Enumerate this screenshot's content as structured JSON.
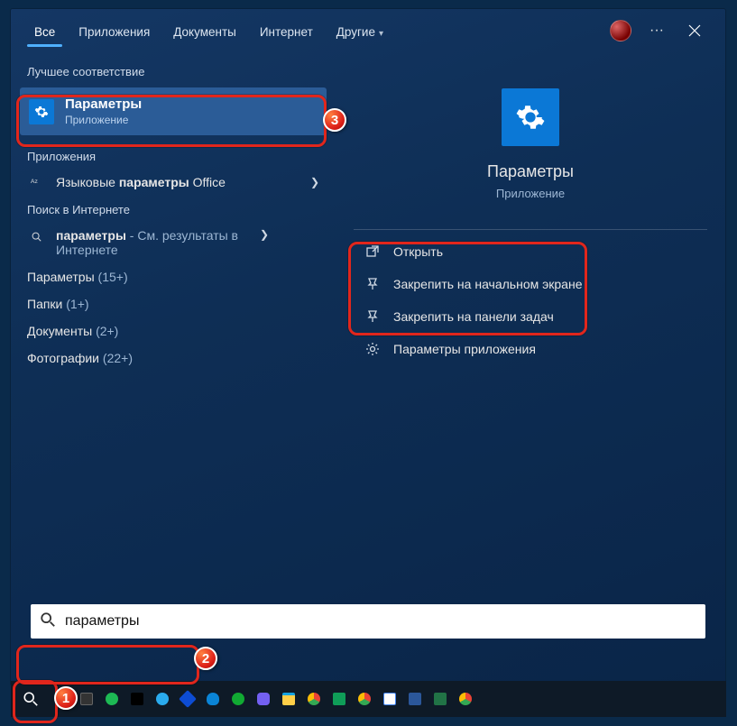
{
  "tabs": {
    "all": "Все",
    "apps": "Приложения",
    "docs": "Документы",
    "web": "Интернет",
    "more": "Другие"
  },
  "sections": {
    "best_match": "Лучшее соответствие",
    "apps": "Приложения",
    "web_search": "Поиск в Интернете"
  },
  "best": {
    "title": "Параметры",
    "subtitle": "Приложение"
  },
  "apps_row": {
    "prefix": "Языковые ",
    "bold": "параметры",
    "suffix": " Office"
  },
  "web_row": {
    "bold": "параметры",
    "dash": " - ",
    "suffix": "См. результаты в Интернете"
  },
  "categories": {
    "settings": {
      "label": "Параметры",
      "count": "(15+)"
    },
    "folders": {
      "label": "Папки",
      "count": "(1+)"
    },
    "documents": {
      "label": "Документы",
      "count": "(2+)"
    },
    "photos": {
      "label": "Фотографии",
      "count": "(22+)"
    }
  },
  "details": {
    "title": "Параметры",
    "subtitle": "Приложение",
    "actions": {
      "open": "Открыть",
      "pin_start": "Закрепить на начальном экране",
      "pin_taskbar": "Закрепить на панели задач",
      "app_settings": "Параметры приложения"
    }
  },
  "search": {
    "value": "параметры"
  },
  "badges": {
    "n1": "1",
    "n2": "2",
    "n3": "3"
  }
}
